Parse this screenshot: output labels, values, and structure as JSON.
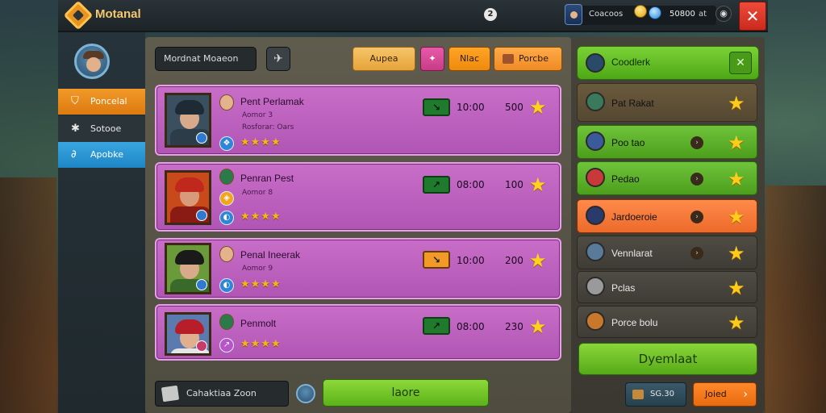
{
  "topbar": {
    "brand": "Motanal",
    "badge_count": "2",
    "currency_label": "Coacoos",
    "currency_value": "50800",
    "currency_unit": "at",
    "close_label": "✕"
  },
  "sidebar": {
    "tabs": [
      {
        "label": "Poncelal",
        "icon": "shield-icon"
      },
      {
        "label": "Sotooe",
        "icon": "runner-icon"
      },
      {
        "label": "Apobke",
        "icon": "link-icon"
      }
    ]
  },
  "toolbar": {
    "filter_label": "Mordnat Moaeon",
    "chips": [
      {
        "label": "Aupea"
      },
      {
        "label": "✦"
      },
      {
        "label": "Nlac"
      },
      {
        "label": "Porcbe"
      }
    ]
  },
  "heroes": [
    {
      "name": "Pent Perlamak",
      "sub1": "Aomor 3",
      "sub2": "Rosforar: Oars",
      "stars": "★★★★",
      "trend": "↘",
      "time": "10:00",
      "score": "500",
      "colors": {
        "hair": "#1e2a34",
        "face": "#d8a98a",
        "body": "#2c3c48",
        "bg": "#3a5060"
      }
    },
    {
      "name": "Penran Pest",
      "sub1": "Aomor 8",
      "stars": "★★★★",
      "trend": "↗",
      "time": "08:00",
      "score": "100",
      "colors": {
        "hair": "#c0281e",
        "face": "#d89a7a",
        "body": "#8a1a14",
        "bg": "#c84a1a"
      }
    },
    {
      "name": "Penal Ineerak",
      "sub1": "Aomor 9",
      "stars": "★★★★",
      "trend": "↘",
      "time": "10:00",
      "score": "200",
      "colors": {
        "hair": "#1a1a1a",
        "face": "#d8a98a",
        "body": "#3a6a2a",
        "bg": "#6a9a3a"
      }
    },
    {
      "name": "Penmolt",
      "stars": "★★★★",
      "trend": "↗",
      "time": "08:00",
      "score": "230",
      "colors": {
        "hair": "#b81e28",
        "face": "#e0b08e",
        "body": "#e6e6e6",
        "bg": "#5a7ab0"
      }
    }
  ],
  "bottom": {
    "box_label": "Cahaktiaa Zoon",
    "primary_label": "laore"
  },
  "right": {
    "header_label": "Coodlerk",
    "rows": [
      {
        "label": "Pat Rakat",
        "style": "row-brown",
        "icon_color": "#3a7a5a"
      },
      {
        "label": "Poo tao",
        "style": "row-green",
        "icon_color": "#3a5a9a"
      },
      {
        "label": "Pedao",
        "style": "row-green",
        "icon_color": "#c83a3a"
      },
      {
        "label": "Jardoeroie",
        "style": "row-orange",
        "icon_color": "#2a3a6a"
      },
      {
        "label": "Vennlarat",
        "style": "row-grey",
        "icon_color": "#5a7a9a"
      },
      {
        "label": "Pclas",
        "style": "row-grey",
        "icon_color": "#9a9a9a"
      },
      {
        "label": "Porce bolu",
        "style": "row-grey",
        "icon_color": "#c8782a"
      }
    ],
    "big_button_label": "Dyemlaat",
    "pill_label": "SG.30",
    "next_label": "Joied"
  }
}
